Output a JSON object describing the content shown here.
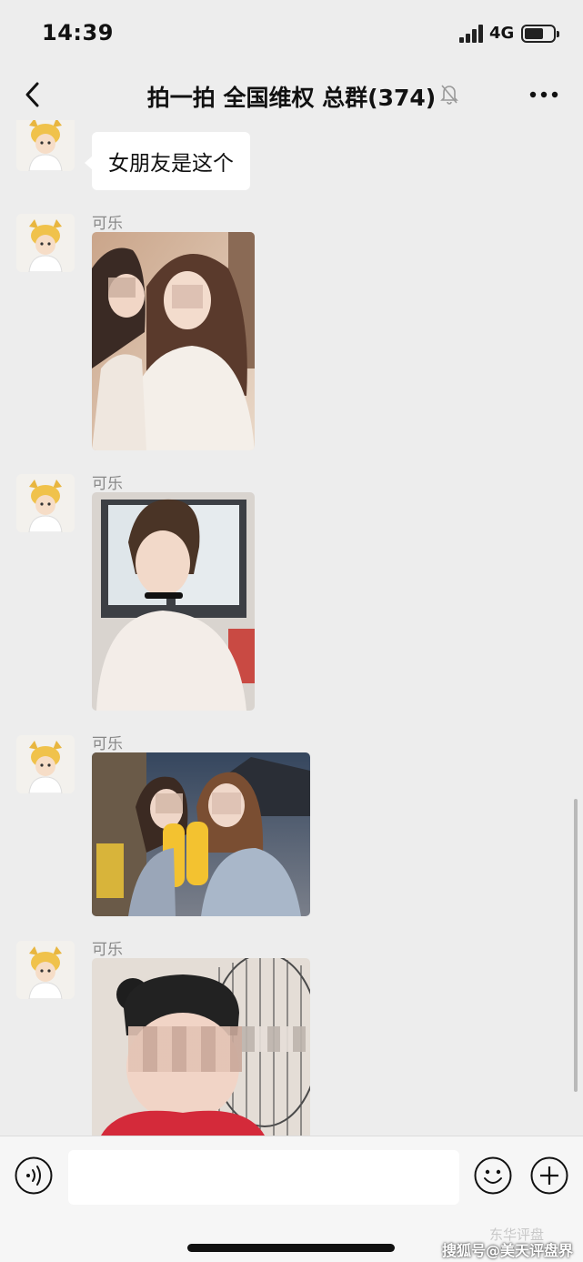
{
  "status_bar": {
    "time": "14:39",
    "network": "4G",
    "battery_fraction": 0.62
  },
  "nav": {
    "title": "拍一拍 全国维权 总群(374)",
    "back_icon": "chevron-left-icon",
    "mute_icon": "bell-off-icon",
    "more_icon": "more-dots-icon"
  },
  "messages": [
    {
      "type": "text",
      "sender": "",
      "text": "女朋友是这个"
    },
    {
      "type": "image",
      "sender": "可乐",
      "description_icon": "photo"
    },
    {
      "type": "image",
      "sender": "可乐",
      "description_icon": "photo"
    },
    {
      "type": "image",
      "sender": "可乐",
      "description_icon": "photo"
    },
    {
      "type": "image",
      "sender": "可乐",
      "description_icon": "photo"
    }
  ],
  "input_bar": {
    "placeholder": "",
    "voice_icon": "voice-icon",
    "emoji_icon": "emoji-icon",
    "add_icon": "plus-icon"
  },
  "watermark": {
    "faint": "东华评盘",
    "main": "搜狐号@美天评盘界"
  },
  "colors": {
    "background": "#ededed",
    "bubble": "#ffffff",
    "sender_text": "#888888"
  }
}
